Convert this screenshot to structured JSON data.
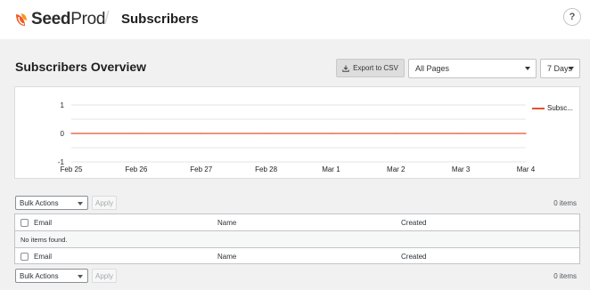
{
  "header": {
    "brand_bold": "Seed",
    "brand_light": "Prod",
    "separator": "/",
    "page_title": "Subscribers",
    "help_icon": "question-circle-icon"
  },
  "overview": {
    "title": "Subscribers Overview",
    "export_label": "Export to CSV",
    "export_icon": "download-icon",
    "pages_select_value": "All Pages",
    "days_select_value": "7 Days"
  },
  "chart_data": {
    "type": "line",
    "x": [
      "Feb 25",
      "Feb 26",
      "Feb 27",
      "Feb 28",
      "Mar 1",
      "Mar 2",
      "Mar 3",
      "Mar 4"
    ],
    "series": [
      {
        "name": "Subsc...",
        "values": [
          0,
          0,
          0,
          0,
          0,
          0,
          0,
          0
        ],
        "color": "#e2542a"
      }
    ],
    "y_ticks": [
      1,
      0,
      -1
    ],
    "ylim": [
      -1,
      1
    ],
    "grid": true,
    "legend": "right"
  },
  "table_top": {
    "bulk_actions": "Bulk Actions",
    "apply_label": "Apply",
    "count_label": "0 items"
  },
  "table": {
    "columns": [
      "Email",
      "Name",
      "Created"
    ],
    "empty_message": "No items found."
  },
  "table_bottom": {
    "bulk_actions": "Bulk Actions",
    "apply_label": "Apply",
    "count_label": "0 items"
  }
}
